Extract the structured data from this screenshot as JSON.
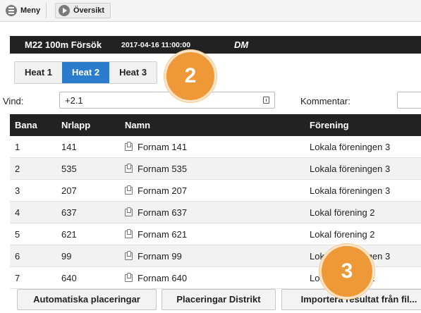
{
  "topbar": {
    "menu_label": "Meny",
    "overview_label": "Översikt"
  },
  "event": {
    "title": "M22 100m Försök",
    "datetime": "2017-04-16 11:00:00",
    "code": "DM"
  },
  "heats": {
    "tabs": [
      "Heat 1",
      "Heat 2",
      "Heat 3"
    ],
    "active": "Heat 2"
  },
  "callouts": [
    "2",
    "3"
  ],
  "wind": {
    "label": "Vind:",
    "value": "+2.1"
  },
  "comment": {
    "label": "Kommentar:",
    "value": ""
  },
  "table": {
    "headers": [
      "Bana",
      "Nrlapp",
      "Namn",
      "Förening"
    ],
    "rows": [
      {
        "bana": "1",
        "nrlapp": "141",
        "namn": "Fornam 141",
        "forening": "Lokala föreningen 3"
      },
      {
        "bana": "2",
        "nrlapp": "535",
        "namn": "Fornam 535",
        "forening": "Lokala föreningen 3"
      },
      {
        "bana": "3",
        "nrlapp": "207",
        "namn": "Fornam 207",
        "forening": "Lokala föreningen 3"
      },
      {
        "bana": "4",
        "nrlapp": "637",
        "namn": "Fornam 637",
        "forening": "Lokal förening 2"
      },
      {
        "bana": "5",
        "nrlapp": "621",
        "namn": "Fornam 621",
        "forening": "Lokal förening 2"
      },
      {
        "bana": "6",
        "nrlapp": "99",
        "namn": "Fornam 99",
        "forening": "Lokala föreningen 3"
      },
      {
        "bana": "7",
        "nrlapp": "640",
        "namn": "Fornam 640",
        "forening": "Lokal förening 2"
      }
    ]
  },
  "actions": {
    "auto_place": "Automatiska placeringar",
    "district_place": "Placeringar Distrikt",
    "import_results": "Importera resultat från fil..."
  },
  "icons": {
    "menu": "menu-icon",
    "overview": "arrow-right-icon",
    "athlete": "athlete-icon",
    "field": "field-info-icon"
  },
  "colors": {
    "active_tab": "#2c7ccd",
    "header_bg": "#222222",
    "callout": "#ef9838"
  }
}
